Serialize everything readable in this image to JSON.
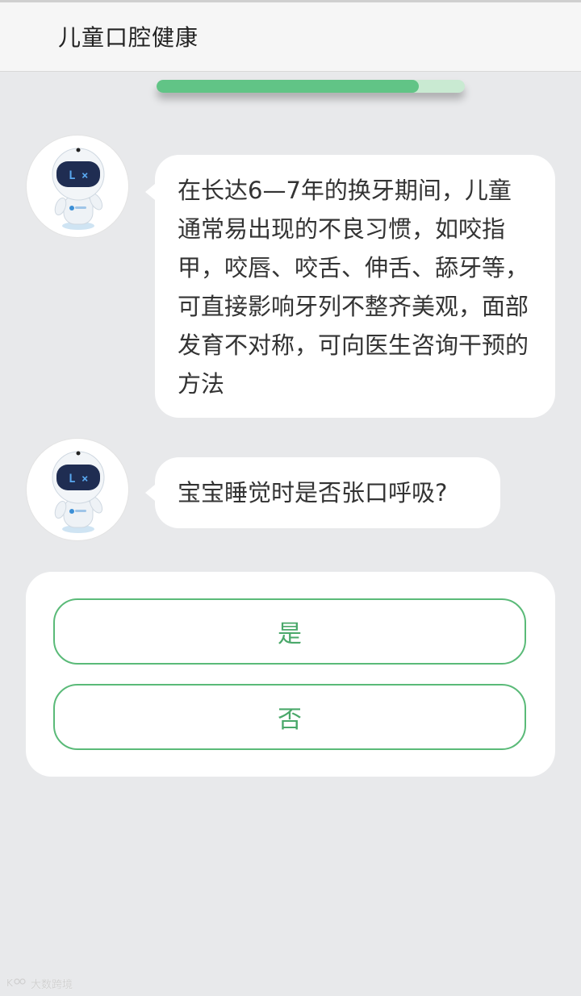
{
  "header": {
    "title": "儿童口腔健康"
  },
  "progress": {
    "fraction": 0.85
  },
  "messages": [
    {
      "text": "在长达6—7年的换牙期间，儿童通常易出现的不良习惯，如咬指甲，咬唇、咬舌、伸舌、舔牙等，可直接影响牙列不整齐美观，面部发育不对称，可向医生咨询干预的方法"
    },
    {
      "text": "宝宝睡觉时是否张口呼吸?"
    }
  ],
  "options": {
    "yes": "是",
    "no": "否"
  },
  "watermark": {
    "text": "大数跨境",
    "icon": "watermark-logo-icon"
  },
  "colors": {
    "accent": "#5aba78",
    "background": "#e8e9eb",
    "progress": "#61c486"
  }
}
